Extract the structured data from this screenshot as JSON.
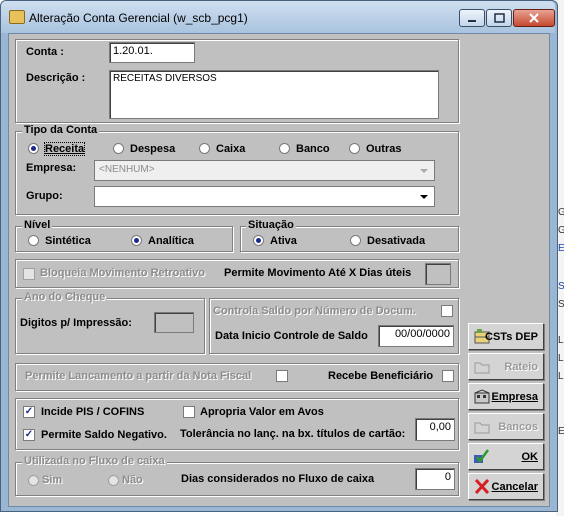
{
  "window": {
    "title": "Alteração Conta Gerencial (w_scb_pcg1)"
  },
  "background_chars": [
    "G",
    "G",
    "E",
    "S",
    "S",
    "L",
    "L",
    "L",
    "E"
  ],
  "conta": {
    "label": "Conta :",
    "value": "1.20.01."
  },
  "descricao": {
    "label": "Descrição :",
    "value": "RECEITAS DIVERSOS"
  },
  "tipo_conta": {
    "legend": "Tipo da Conta",
    "options": [
      "Receita",
      "Despesa",
      "Caixa",
      "Banco",
      "Outras"
    ],
    "selected": "Receita",
    "empresa_label": "Empresa:",
    "empresa_value": "<NENHUM>",
    "grupo_label": "Grupo:",
    "grupo_value": ""
  },
  "nivel": {
    "legend": "Nível",
    "options": [
      "Sintética",
      "Analítica"
    ],
    "selected": "Analítica"
  },
  "situacao": {
    "legend": "Situação",
    "options": [
      "Ativa",
      "Desativada"
    ],
    "selected": "Ativa"
  },
  "bloqueia": {
    "label": "Bloqueia Movimento Retroativo",
    "checked": false,
    "dias_label": "Permite Movimento Até X Dias úteis",
    "dias_value": ""
  },
  "ano_cheque": {
    "legend": "Ano do Cheque",
    "digitos_label": "Digitos p/ Impressão:",
    "digitos_value": ""
  },
  "controle_saldo": {
    "label": "Controla  Saldo por Número de Docum.",
    "checked": false,
    "data_label": "Data Inicio Controle de Saldo",
    "data_value": "00/00/0000"
  },
  "nota_fiscal": {
    "label": "Permite Lancamento a partir da Nota Fiscal",
    "checked": false,
    "beneficiario_label": "Recebe Beneficiário",
    "beneficiario_checked": false
  },
  "impostos": {
    "pis_label": "Incide PIS / COFINS",
    "pis_checked": true,
    "avos_label": "Apropria Valor em Avos",
    "avos_checked": false,
    "saldo_neg_label": "Permite Saldo Negativo.",
    "saldo_neg_checked": true,
    "tolerancia_label": "Tolerância no lanç. na bx. títulos de cartão:",
    "tolerancia_value": "0,00"
  },
  "fluxo": {
    "legend": "Utilizada no Fluxo de caixa",
    "options": [
      "Sim",
      "Não"
    ],
    "dias_label": "Dias considerados no Fluxo de caixa",
    "dias_value": "0"
  },
  "buttons": {
    "csts": "CSTs DEP",
    "rateio": "Rateio",
    "empresa": "Empresa",
    "bancos": "Bancos",
    "ok": "OK",
    "cancelar": "Cancelar"
  },
  "colors": {
    "title_bar": "#a9c3df",
    "client_bg": "#c0c0c0",
    "close_button": "#c44a30",
    "selected_radio": "#1a2a8a"
  }
}
